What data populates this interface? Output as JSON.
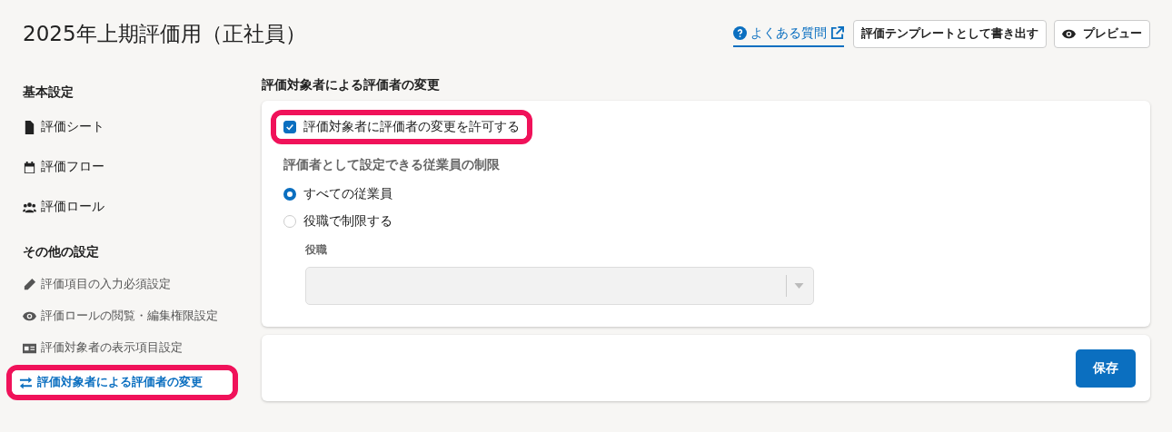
{
  "title": "2025年上期評価用（正社員）",
  "header": {
    "faq_link": "よくある質問",
    "buttons": [
      {
        "label": "評価テンプレートとして書き出す"
      },
      {
        "label": "プレビュー"
      }
    ]
  },
  "sidebar": {
    "sections": [
      {
        "heading": "基本設定",
        "items": [
          {
            "label": "評価シート",
            "selected": false,
            "highlighted": false
          },
          {
            "label": "評価フロー",
            "selected": false,
            "highlighted": false
          },
          {
            "label": "評価ロール",
            "selected": false,
            "highlighted": false
          }
        ]
      },
      {
        "heading": "その他の設定",
        "items": [
          {
            "label": "評価項目の入力必須設定",
            "selected": false,
            "highlighted": false
          },
          {
            "label": "評価ロールの閲覧・編集権限設定",
            "selected": false,
            "highlighted": false
          },
          {
            "label": "評価対象者の表示項目設定",
            "selected": false,
            "highlighted": false
          },
          {
            "label": "評価対象者による評価者の変更",
            "selected": true,
            "highlighted": true
          }
        ]
      }
    ]
  },
  "main": {
    "heading": "評価対象者による評価者の変更",
    "allow_checkbox": {
      "label": "評価対象者に評価者の変更を許可する",
      "checked": true,
      "highlighted": true
    },
    "restriction": {
      "heading": "評価者として設定できる従業員の制限",
      "options": [
        {
          "label": "すべての従業員",
          "selected": true
        },
        {
          "label": "役職で制限する",
          "selected": false
        }
      ],
      "position_field": {
        "label": "役職",
        "disabled": true
      }
    },
    "save_button": "保存"
  }
}
